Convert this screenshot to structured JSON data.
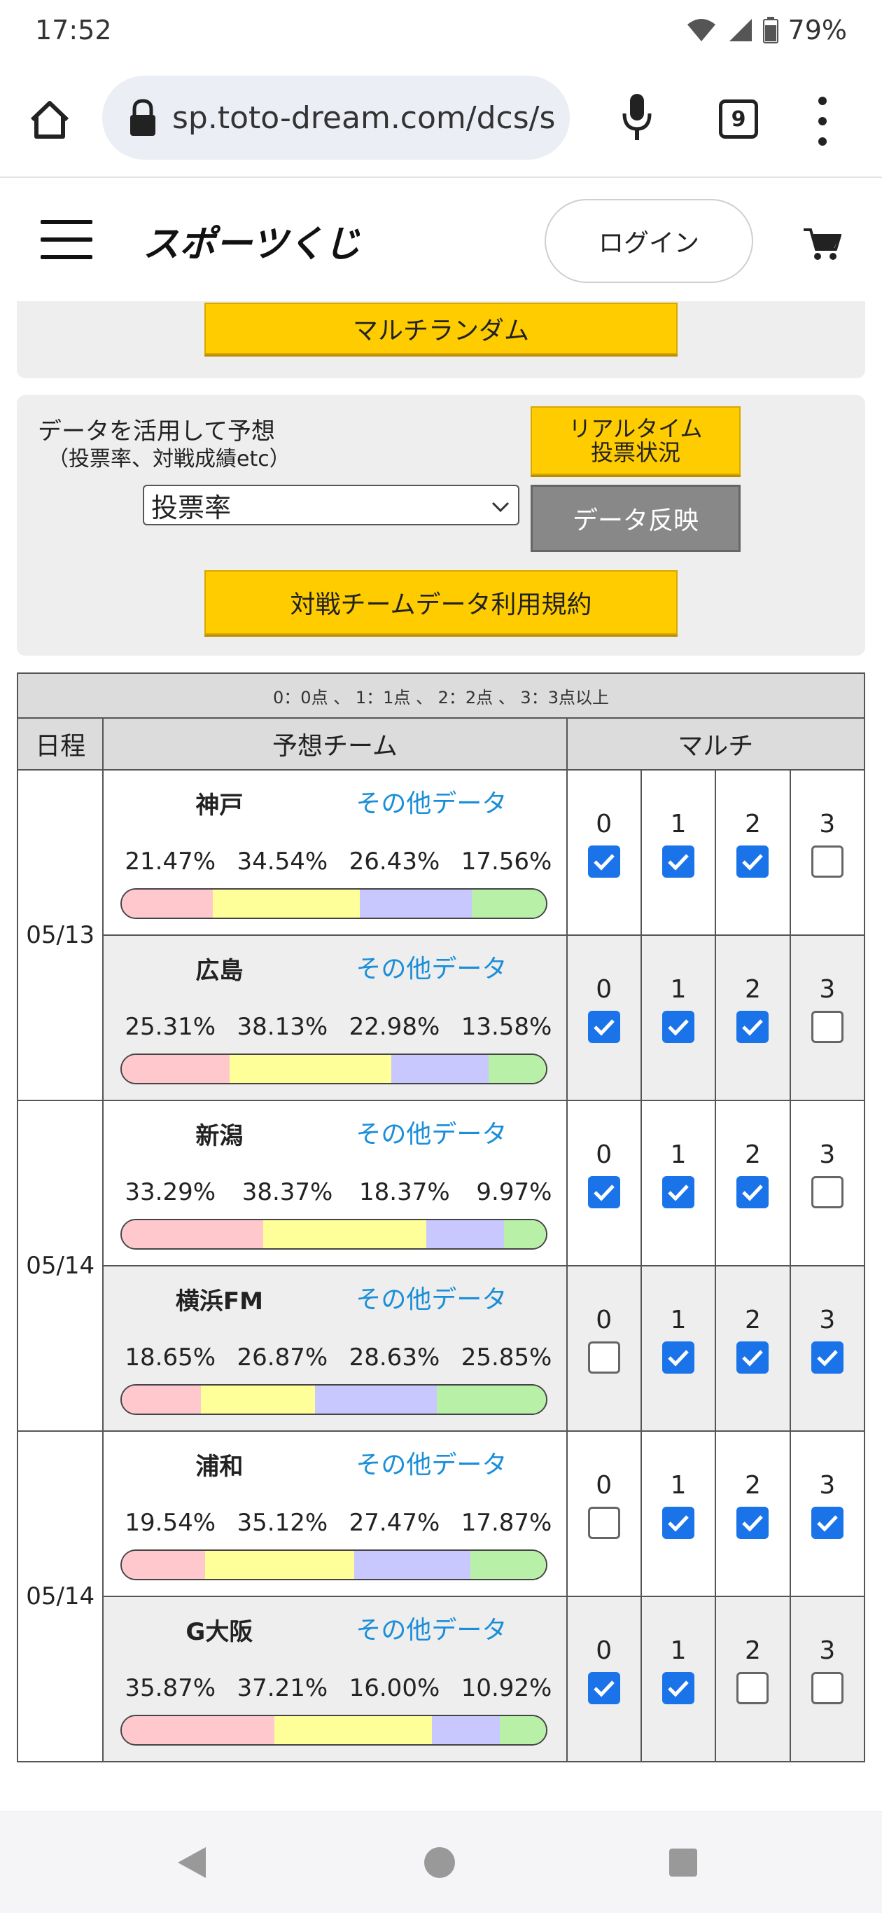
{
  "status": {
    "time": "17:52",
    "battery": "79%"
  },
  "browser": {
    "url": "sp.toto-dream.com/dcs/s",
    "tab_count": "9"
  },
  "header": {
    "logo": "スポーツくじ",
    "login": "ログイン"
  },
  "buttons": {
    "multi_random": "マルチランダム",
    "realtime_line1": "リアルタイム",
    "realtime_line2": "投票状況",
    "data_reflect": "データ反映",
    "terms": "対戦チームデータ利用規約"
  },
  "predict": {
    "label1": "データを活用して予想",
    "label2": "（投票率、対戦成績etc）",
    "select_value": "投票率"
  },
  "table": {
    "legend": "0：0点 、 1：1点 、 2：2点 、 3：3点以上",
    "headers": {
      "date": "日程",
      "team": "予想チーム",
      "multi": "マルチ"
    },
    "other_label": "その他データ",
    "score_labels": [
      "0",
      "1",
      "2",
      "3"
    ],
    "matches": [
      {
        "date": "05/13",
        "teams": [
          {
            "name": "神戸",
            "pcts": [
              "21.47%",
              "34.54%",
              "26.43%",
              "17.56%"
            ],
            "shares": [
              21.47,
              34.54,
              26.43,
              17.56
            ],
            "checks": [
              true,
              true,
              true,
              false
            ]
          },
          {
            "name": "広島",
            "pcts": [
              "25.31%",
              "38.13%",
              "22.98%",
              "13.58%"
            ],
            "shares": [
              25.31,
              38.13,
              22.98,
              13.58
            ],
            "checks": [
              true,
              true,
              true,
              false
            ]
          }
        ]
      },
      {
        "date": "05/14",
        "teams": [
          {
            "name": "新潟",
            "pcts": [
              "33.29%",
              "38.37%",
              "18.37%",
              "9.97%"
            ],
            "shares": [
              33.29,
              38.37,
              18.37,
              9.97
            ],
            "checks": [
              true,
              true,
              true,
              false
            ]
          },
          {
            "name": "横浜FM",
            "pcts": [
              "18.65%",
              "26.87%",
              "28.63%",
              "25.85%"
            ],
            "shares": [
              18.65,
              26.87,
              28.63,
              25.85
            ],
            "checks": [
              false,
              true,
              true,
              true
            ]
          }
        ]
      },
      {
        "date": "05/14",
        "teams": [
          {
            "name": "浦和",
            "pcts": [
              "19.54%",
              "35.12%",
              "27.47%",
              "17.87%"
            ],
            "shares": [
              19.54,
              35.12,
              27.47,
              17.87
            ],
            "checks": [
              false,
              true,
              true,
              true
            ]
          },
          {
            "name": "G大阪",
            "pcts": [
              "35.87%",
              "37.21%",
              "16.00%",
              "10.92%"
            ],
            "shares": [
              35.87,
              37.21,
              16.0,
              10.92
            ],
            "checks": [
              true,
              true,
              false,
              false
            ]
          }
        ]
      }
    ]
  }
}
